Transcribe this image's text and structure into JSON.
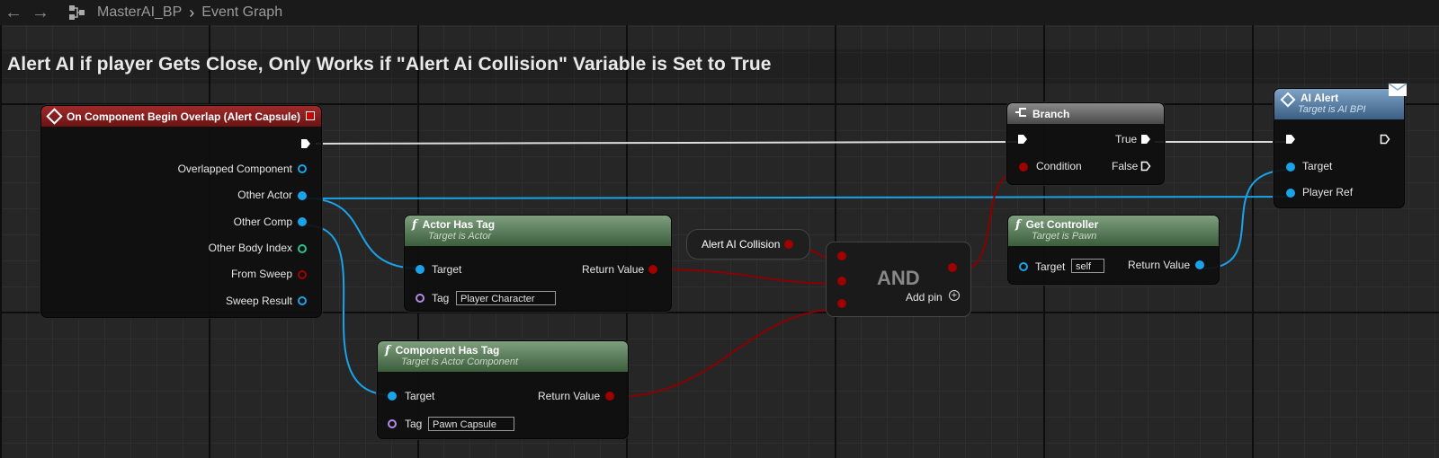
{
  "breadcrumb": {
    "blueprint": "MasterAI_BP",
    "graph": "Event Graph"
  },
  "comment": {
    "text": "Alert AI if player Gets Close, Only Works if \"Alert Ai Collision\" Variable is Set to True"
  },
  "event_node": {
    "title": "On Component Begin Overlap (Alert Capsule)",
    "pins": [
      "Overlapped Component",
      "Other Actor",
      "Other Comp",
      "Other Body Index",
      "From Sweep",
      "Sweep Result"
    ]
  },
  "actor_has_tag": {
    "title": "Actor Has Tag",
    "subtitle": "Target is Actor",
    "target": "Target",
    "tag": "Tag",
    "tag_value": "Player Character",
    "return": "Return Value"
  },
  "component_has_tag": {
    "title": "Component Has Tag",
    "subtitle": "Target is Actor Component",
    "target": "Target",
    "tag": "Tag",
    "tag_value": "Pawn Capsule",
    "return": "Return Value"
  },
  "variable_node": {
    "label": "Alert AI Collision"
  },
  "and_node": {
    "label": "AND",
    "add_pin": "Add pin"
  },
  "branch": {
    "title": "Branch",
    "condition": "Condition",
    "true": "True",
    "false": "False"
  },
  "get_controller": {
    "title": "Get Controller",
    "subtitle": "Target is Pawn",
    "target": "Target",
    "target_value": "self",
    "return": "Return Value"
  },
  "ai_alert": {
    "title": "AI Alert",
    "subtitle": "Target is AI BPI",
    "target": "Target",
    "player_ref": "Player Ref"
  },
  "colors": {
    "event": "#a02a2a",
    "function": "#5f7f5f",
    "object_pin": "#1aa3e8",
    "bool_pin": "#a00000",
    "name_pin": "#b48ce8",
    "int_pin": "#29c58f"
  }
}
